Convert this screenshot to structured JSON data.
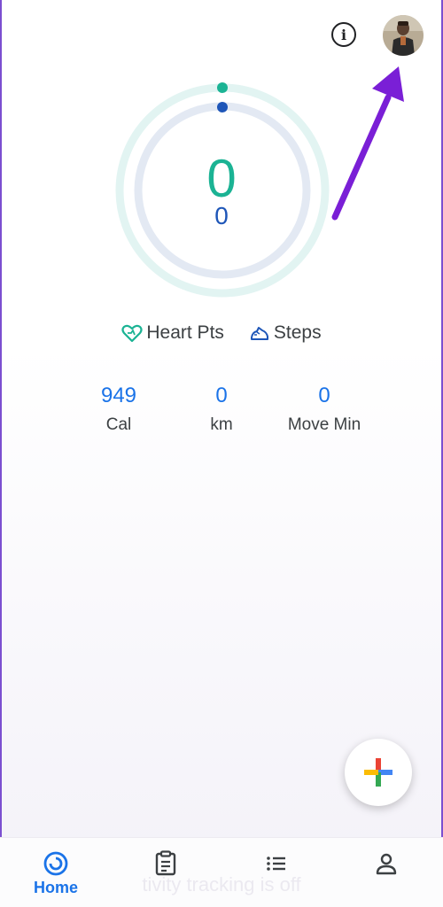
{
  "header": {
    "info_icon": "info-icon",
    "avatar": "profile-avatar"
  },
  "summary": {
    "heart_points_value": "0",
    "steps_value": "0",
    "legend": {
      "heart_points_label": "Heart Pts",
      "steps_label": "Steps"
    }
  },
  "stats": [
    {
      "value": "949",
      "label": "Cal"
    },
    {
      "value": "0",
      "label": "km"
    },
    {
      "value": "0",
      "label": "Move Min"
    }
  ],
  "fab": {
    "icon": "add-plus-icon"
  },
  "bottom_nav": {
    "items": [
      {
        "label": "Home",
        "icon": "home-ring-icon",
        "active": true
      },
      {
        "label": "",
        "icon": "journal-clipboard-icon"
      },
      {
        "label": "",
        "icon": "browse-list-icon"
      },
      {
        "label": "",
        "icon": "profile-icon"
      }
    ],
    "faded_notice": "tivity tracking is off"
  },
  "colors": {
    "heart_points": "#1bb394",
    "steps": "#1e56b8",
    "accent_blue": "#1a73e8",
    "annotation_arrow": "#7a1fd6"
  }
}
